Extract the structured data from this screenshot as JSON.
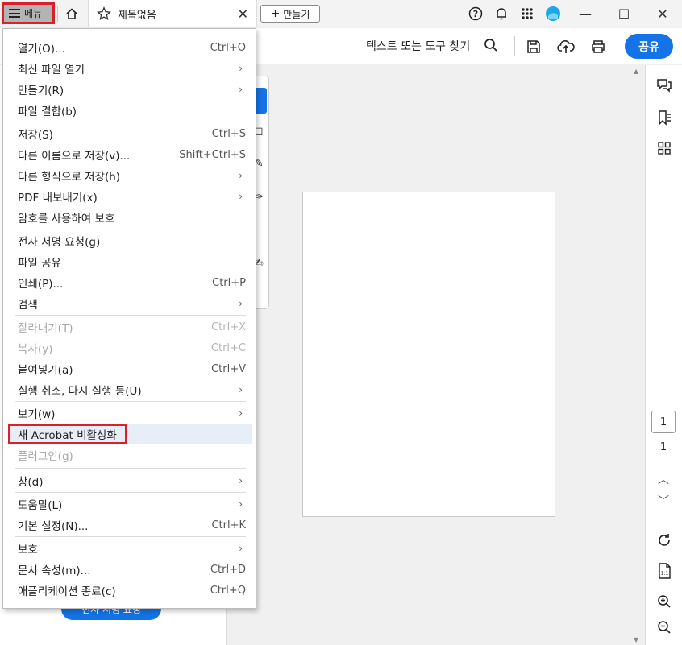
{
  "titlebar": {
    "menu_label": "메뉴",
    "tab_title": "제목없음",
    "create_label": "만들기"
  },
  "toolbar": {
    "find_text": "텍스트 또는 도구 찾기",
    "share_label": "공유"
  },
  "left_panel": {
    "bottom_button_label": "전자 서명 요청"
  },
  "page_nav": {
    "current_page": "1",
    "total_pages": "1"
  },
  "menu": {
    "items": [
      {
        "label": "열기(O)...",
        "shortcut": "Ctrl+O"
      },
      {
        "label": "최신 파일 열기",
        "arrow": "›"
      },
      {
        "label": "만들기(R)",
        "arrow": "›"
      },
      {
        "label": "파일 결합(b)"
      },
      {
        "label": "저장(S)",
        "shortcut": "Ctrl+S"
      },
      {
        "label": "다른 이름으로 저장(v)...",
        "shortcut": "Shift+Ctrl+S"
      },
      {
        "label": "다른 형식으로 저장(h)",
        "arrow": "›"
      },
      {
        "label": "PDF 내보내기(x)",
        "arrow": "›"
      },
      {
        "label": "암호를 사용하여 보호"
      },
      {
        "label": "전자 서명 요청(g)"
      },
      {
        "label": "파일 공유"
      },
      {
        "label": "인쇄(P)...",
        "shortcut": "Ctrl+P"
      },
      {
        "label": "검색",
        "arrow": "›"
      },
      {
        "label": "잘라내기(T)",
        "shortcut": "Ctrl+X"
      },
      {
        "label": "복사(y)",
        "shortcut": "Ctrl+C"
      },
      {
        "label": "붙여넣기(a)",
        "shortcut": "Ctrl+V"
      },
      {
        "label": "실행 취소, 다시 실행 등(U)",
        "arrow": "›"
      },
      {
        "label": "보기(w)",
        "arrow": "›"
      },
      {
        "label": "새 Acrobat 비활성화"
      },
      {
        "label": "플러그인(g)"
      },
      {
        "label": "창(d)",
        "arrow": "›"
      },
      {
        "label": "도움말(L)",
        "arrow": "›"
      },
      {
        "label": "기본 설정(N)...",
        "shortcut": "Ctrl+K"
      },
      {
        "label": "보호",
        "arrow": "›"
      },
      {
        "label": "문서 속성(m)...",
        "shortcut": "Ctrl+D"
      },
      {
        "label": "애플리케이션 종료(c)",
        "shortcut": "Ctrl+Q"
      }
    ]
  },
  "colors": {
    "accent": "#1473e6",
    "highlight_box": "#d9212b",
    "menu_hover": "#e8eef8"
  }
}
